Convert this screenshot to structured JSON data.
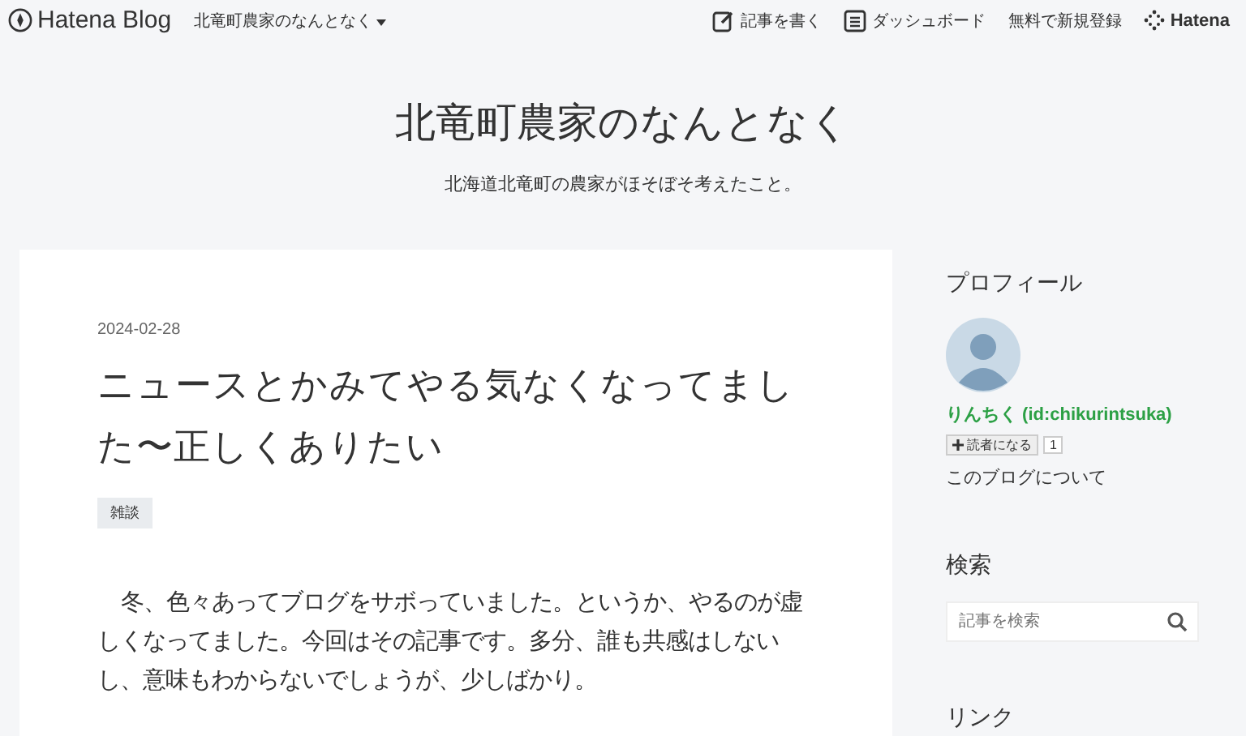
{
  "topbar": {
    "brand": "Hatena Blog",
    "blog_menu": "北竜町農家のなんとなく",
    "links": [
      {
        "kind": "write",
        "label": "記事を書く"
      },
      {
        "kind": "dashboard",
        "label": "ダッシュボード"
      },
      {
        "kind": "plain",
        "label": "無料で新規登録"
      },
      {
        "kind": "hatena",
        "label": "Hatena"
      }
    ]
  },
  "header": {
    "title": "北竜町農家のなんとなく",
    "description": "北海道北竜町の農家がほそぼそ考えたこと。"
  },
  "article": {
    "date": "2024-02-28",
    "title": "ニュースとかみてやる気なくなってました〜正しくありたい",
    "categories": [
      "雑談"
    ],
    "body": "冬、色々あってブログをサボっていました。というか、やるのが虚しくなってました。今回はその記事です。多分、誰も共感はしないし、意味もわからないでしょうが、少しばかり。"
  },
  "sidebar": {
    "profile": {
      "heading": "プロフィール",
      "name": "りんちく (id:chikurintsuka)",
      "subscribe_label": "読者になる",
      "subscribers": "1",
      "about_link": "このブログについて"
    },
    "search": {
      "heading": "検索",
      "placeholder": "記事を検索"
    },
    "links": {
      "heading": "リンク"
    }
  }
}
